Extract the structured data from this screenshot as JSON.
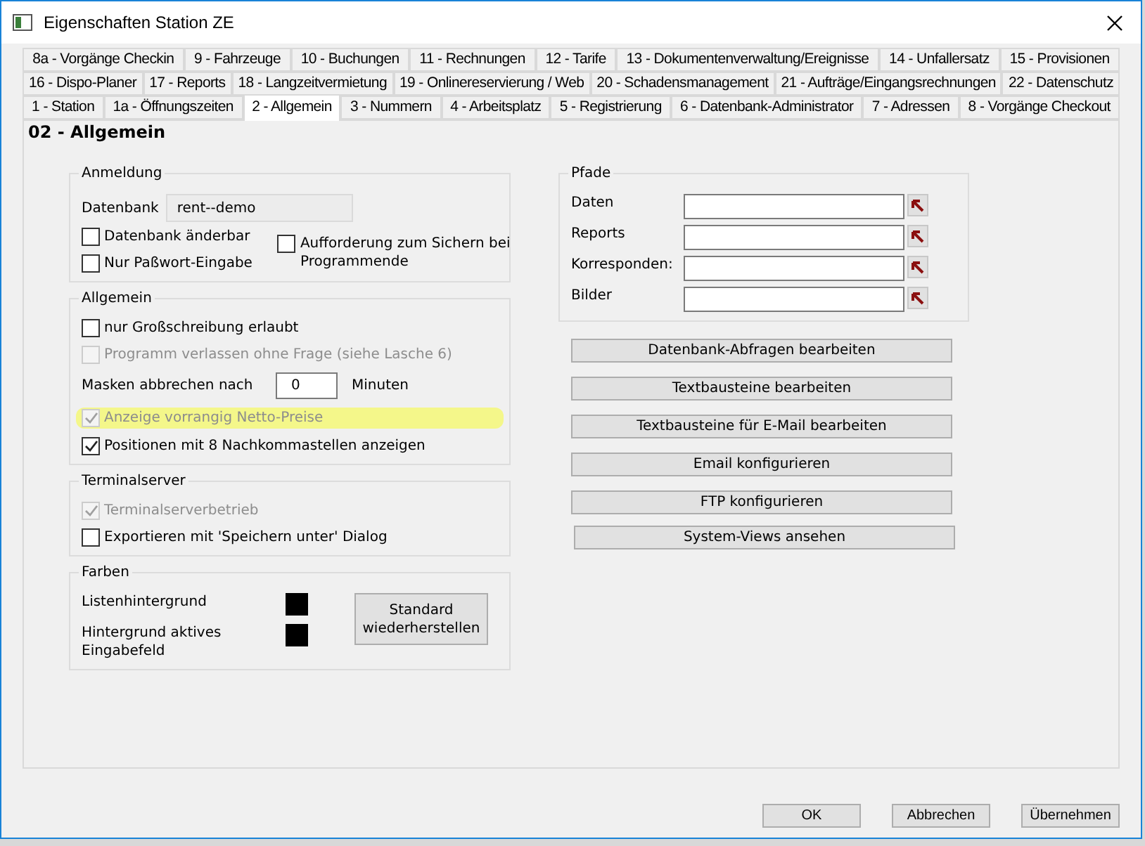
{
  "window": {
    "title": "Eigenschaften Station ZE"
  },
  "tab_rows": [
    [
      {
        "label": "8a - Vorgänge Checkin",
        "selected": false
      },
      {
        "label": "9 - Fahrzeuge",
        "selected": false
      },
      {
        "label": "10 - Buchungen",
        "selected": false
      },
      {
        "label": "11 - Rechnungen",
        "selected": false
      },
      {
        "label": "12 - Tarife",
        "selected": false
      },
      {
        "label": "13 - Dokumentenverwaltung/Ereignisse",
        "selected": false
      },
      {
        "label": "14 - Unfallersatz",
        "selected": false
      },
      {
        "label": "15 - Provisionen",
        "selected": false
      }
    ],
    [
      {
        "label": "16 - Dispo-Planer",
        "selected": false
      },
      {
        "label": "17 - Reports",
        "selected": false
      },
      {
        "label": "18 - Langzeitvermietung",
        "selected": false
      },
      {
        "label": "19 - Onlinereservierung / Web",
        "selected": false
      },
      {
        "label": "20 - Schadensmanagement",
        "selected": false
      },
      {
        "label": "21 - Aufträge/Eingangsrechnungen",
        "selected": false
      },
      {
        "label": "22 - Datenschutz",
        "selected": false
      }
    ],
    [
      {
        "label": "1 - Station",
        "selected": false
      },
      {
        "label": "1a - Öffnungszeiten",
        "selected": false
      },
      {
        "label": "2 - Allgemein",
        "selected": true
      },
      {
        "label": "3 - Nummern",
        "selected": false
      },
      {
        "label": "4 - Arbeitsplatz",
        "selected": false
      },
      {
        "label": "5 - Registrierung",
        "selected": false
      },
      {
        "label": "6 - Datenbank-Administrator",
        "selected": false
      },
      {
        "label": "7 - Adressen",
        "selected": false
      },
      {
        "label": "8 - Vorgänge Checkout",
        "selected": false
      }
    ]
  ],
  "page_heading": "02 - Allgemein",
  "anmeldung": {
    "title": "Anmeldung",
    "database_label": "Datenbank",
    "database_value": "rent--demo",
    "checkboxes": [
      {
        "label": "Datenbank änderbar",
        "checked": false
      },
      {
        "label": "Nur Paßwort-Eingabe",
        "checked": false
      },
      {
        "label": "Aufforderung zum Sichern bei Programmende",
        "checked": false
      }
    ]
  },
  "allgemein": {
    "title": "Allgemein",
    "items": [
      {
        "kind": "checkbox",
        "label": "nur Großschreibung erlaubt",
        "checked": false,
        "disabled": false,
        "highlighted": false
      },
      {
        "kind": "checkbox",
        "label": "Programm verlassen ohne Frage (siehe Lasche 6)",
        "checked": false,
        "disabled": true,
        "highlighted": false
      },
      {
        "kind": "number",
        "label": "Masken abbrechen nach",
        "value": "0",
        "unit": "Minuten"
      },
      {
        "kind": "checkbox",
        "label": "Anzeige vorrangig Netto-Preise",
        "checked": true,
        "disabled": true,
        "highlighted": true
      },
      {
        "kind": "checkbox",
        "label": "Positionen mit 8 Nachkommastellen anzeigen",
        "checked": true,
        "disabled": false,
        "highlighted": false
      }
    ]
  },
  "terminalserver": {
    "title": "Terminalserver",
    "checkboxes": [
      {
        "label": "Terminalserverbetrieb",
        "checked": true,
        "disabled": true
      },
      {
        "label": "Exportieren mit 'Speichern unter' Dialog",
        "checked": false,
        "disabled": false
      }
    ]
  },
  "farben": {
    "title": "Farben",
    "items": [
      {
        "label": "Listenhintergrund",
        "color": "#000000"
      },
      {
        "label": "Hintergrund aktives Eingabefeld",
        "color": "#000000"
      }
    ],
    "reset_button": "Standard wiederherstellen"
  },
  "pfade": {
    "title": "Pfade",
    "rows": [
      {
        "label": "Daten"
      },
      {
        "label": "Reports"
      },
      {
        "label": "Korresponden:"
      },
      {
        "label": "Bilder"
      }
    ]
  },
  "action_buttons": [
    "Datenbank-Abfragen bearbeiten",
    "Textbausteine bearbeiten",
    "Textbausteine für E-Mail bearbeiten",
    "Email konfigurieren",
    "FTP konfigurieren",
    "System-Views ansehen"
  ],
  "dialog_buttons": [
    "OK",
    "Abbrechen",
    "Übernehmen"
  ]
}
